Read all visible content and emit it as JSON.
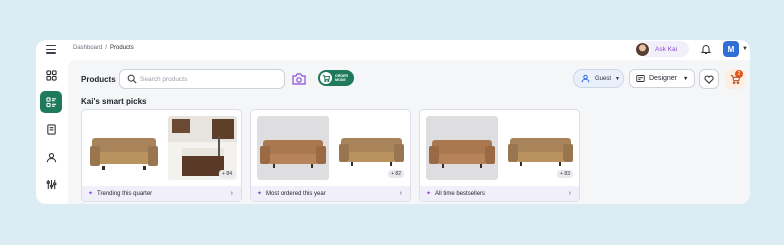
{
  "breadcrumb": {
    "root": "Dashboard",
    "separator": "/",
    "current": "Products"
  },
  "header": {
    "ask_label": "Ask Kai",
    "user_initial": "M"
  },
  "toolbar": {
    "title": "Products",
    "search_placeholder": "Search products",
    "order_mode_line1": "ORDER",
    "order_mode_line2": "MODE",
    "guest_label": "Guest",
    "designer_label": "Designer",
    "cart_count": "2"
  },
  "section": {
    "title": "Kai's smart picks"
  },
  "cards": [
    {
      "label": "Trending this quarter",
      "more": "+ 84"
    },
    {
      "label": "Most ordered this year",
      "more": "+ 82"
    },
    {
      "label": "All time bestsellers",
      "more": "+ 83"
    }
  ],
  "colors": {
    "brand_green": "#1f7a5c",
    "ask_purple": "#8a4dd6",
    "cart_orange": "#e2571e"
  },
  "icons": [
    "menu-icon",
    "bell-icon",
    "search-icon",
    "camera-icon",
    "cart-icon",
    "heart-icon",
    "user-icon",
    "designer-icon",
    "sparkle-icon",
    "chevron-right-icon"
  ]
}
